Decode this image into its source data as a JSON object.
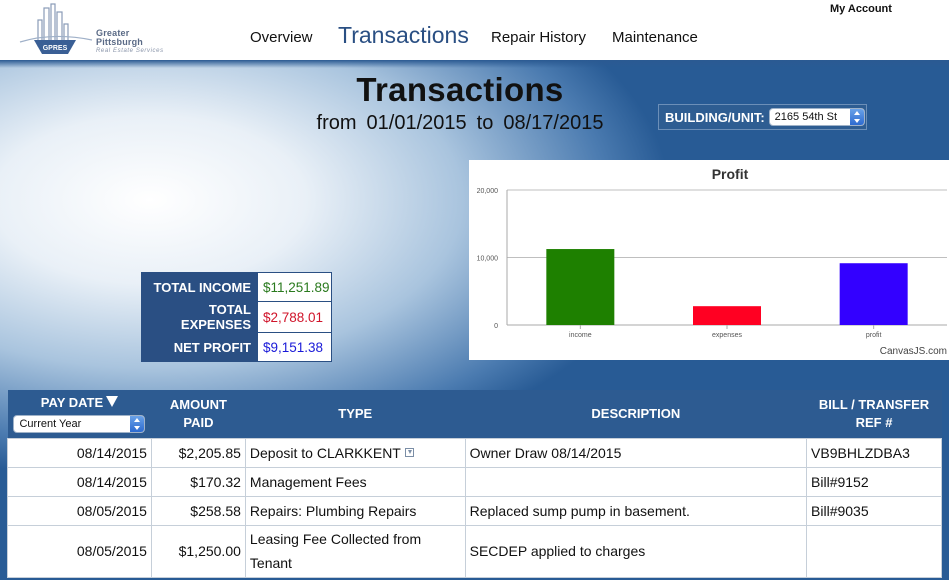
{
  "header": {
    "logo_name": "Greater Pittsburgh",
    "logo_sub": "Real Estate Services",
    "logo_badge": "GPRES",
    "my_account": "My Account",
    "nav": [
      {
        "label": "Overview",
        "active": false
      },
      {
        "label": "Transactions",
        "active": true
      },
      {
        "label": "Repair History",
        "active": false
      },
      {
        "label": "Maintenance",
        "active": false
      }
    ]
  },
  "page": {
    "title": "Transactions",
    "range_from_word": "from",
    "range_start": "01/01/2015",
    "range_to_word": "to",
    "range_end": "08/17/2015"
  },
  "building": {
    "label": "BUILDING/UNIT:",
    "selected": "2165 54th St"
  },
  "summary": {
    "rows": [
      {
        "label": "TOTAL INCOME",
        "value": "$11,251.89",
        "color": "#2a7a1e"
      },
      {
        "label": "TOTAL EXPENSES",
        "value": "$2,788.01",
        "color": "#d0142a"
      },
      {
        "label": "NET PROFIT",
        "value": "$9,151.38",
        "color": "#1a1ad8"
      }
    ]
  },
  "chart_data": {
    "type": "bar",
    "title": "Profit",
    "categories": [
      "income",
      "expenses",
      "profit"
    ],
    "values": [
      11251.89,
      2788.01,
      9151.38
    ],
    "colors": [
      "#1e8000",
      "#ff0022",
      "#3300ff"
    ],
    "ylim": [
      0,
      20000
    ],
    "yticks": [
      "0",
      "10,000",
      "20,000"
    ],
    "ytick_values": [
      0,
      10000,
      20000
    ],
    "grid": true,
    "credit": "CanvasJS.com"
  },
  "table": {
    "headers": {
      "pay_date": "PAY DATE",
      "amount": "AMOUNT PAID",
      "type": "TYPE",
      "description": "DESCRIPTION",
      "bill": "BILL / TRANSFER REF #"
    },
    "period_select": "Current Year",
    "rows": [
      {
        "date": "08/14/2015",
        "amount": "$2,205.85",
        "amount_color": "blue",
        "type": "Deposit to CLARKKENT",
        "has_icon": true,
        "description": "Owner Draw 08/14/2015",
        "ref": "VB9BHLZDBA3",
        "ref_link": false
      },
      {
        "date": "08/14/2015",
        "amount": "$170.32",
        "amount_color": "red",
        "type": "Management Fees",
        "has_icon": false,
        "description": "",
        "ref": "Bill#9152",
        "ref_link": true
      },
      {
        "date": "08/05/2015",
        "amount": "$258.58",
        "amount_color": "red",
        "type": "Repairs: Plumbing Repairs",
        "has_icon": false,
        "description": "Replaced sump pump in basement.",
        "ref": "Bill#9035",
        "ref_link": true
      },
      {
        "date": "08/05/2015",
        "amount": "$1,250.00",
        "amount_color": "green",
        "type": "Leasing Fee Collected from Tenant",
        "has_icon": false,
        "description": "SECDEP applied to charges",
        "ref": "",
        "ref_link": false
      }
    ]
  }
}
